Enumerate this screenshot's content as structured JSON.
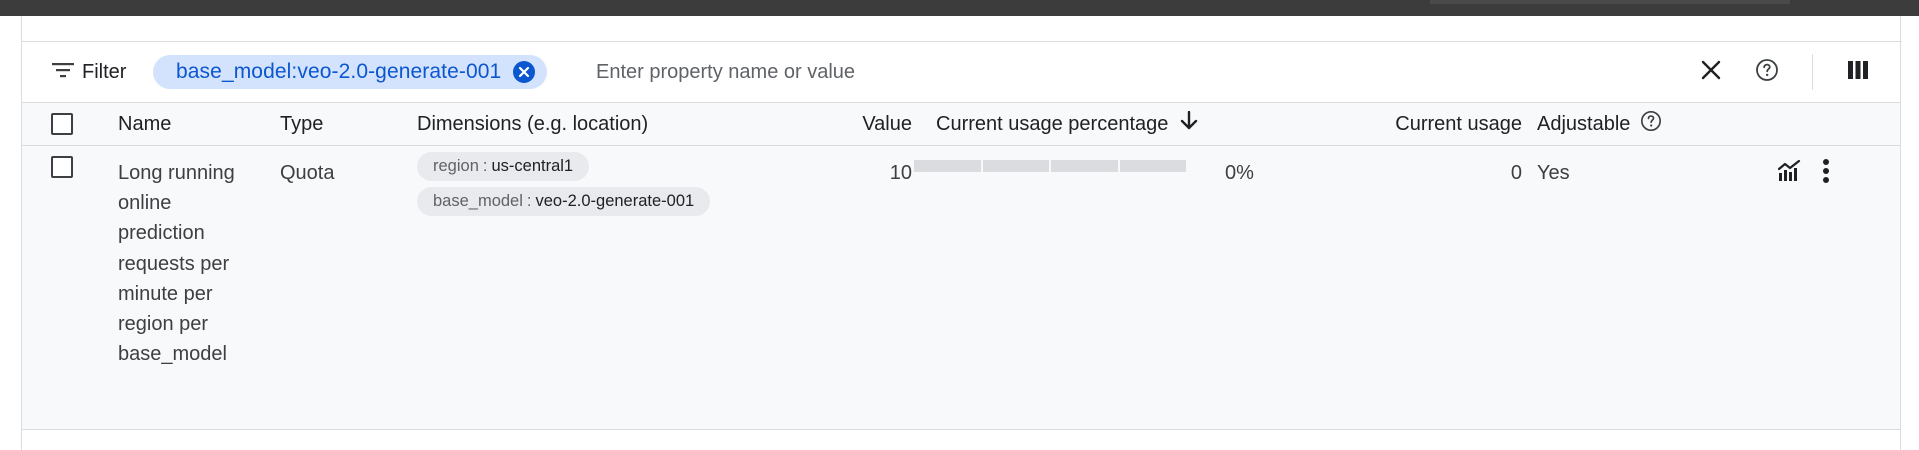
{
  "filterbar": {
    "filter_label": "Filter",
    "chip_text": "base_model:veo-2.0-generate-001",
    "input_placeholder": "Enter property name or value",
    "icons": [
      "filter-list-icon",
      "close-icon",
      "help-icon",
      "column-display-icon"
    ]
  },
  "table": {
    "columns": {
      "name": "Name",
      "type": "Type",
      "dimensions": "Dimensions (e.g. location)",
      "value": "Value",
      "usage_pct": "Current usage percentage",
      "current_usage": "Current usage",
      "adjustable": "Adjustable"
    },
    "sort": {
      "column": "usage_pct",
      "direction": "descending",
      "icon": "arrow-downward-icon"
    },
    "adjustable_help_icon": "help-icon",
    "rows": [
      {
        "name": "Long running online prediction requests per minute per region per base_model",
        "type": "Quota",
        "dimensions": [
          {
            "key": "region",
            "sep": ":",
            "value": "us-central1"
          },
          {
            "key": "base_model",
            "sep": ":",
            "value": "veo-2.0-generate-001"
          }
        ],
        "value": "10",
        "usage_fraction": 0.0,
        "usage_pct": "0%",
        "current_usage": "0",
        "adjustable": "Yes",
        "actions": [
          "monitoring-chart-icon",
          "more-vert-icon"
        ]
      }
    ]
  },
  "colors": {
    "chip_bg": "#d3e3fd",
    "chip_text": "#0b57d0",
    "row_bg": "#f8f9fa",
    "bar_track": "#dadce0"
  }
}
